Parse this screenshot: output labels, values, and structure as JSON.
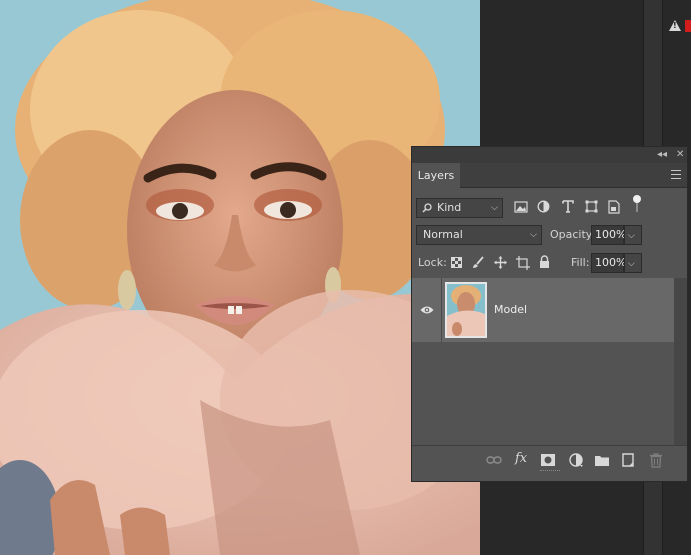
{
  "panel": {
    "tab_label": "Layers",
    "collapse_glyph": "◂◂",
    "close_glyph": "✕"
  },
  "filter": {
    "kind_label": "Kind",
    "filter_icons": [
      "image-filter-icon",
      "adjustment-filter-icon",
      "type-filter-icon",
      "shape-filter-icon",
      "smart-object-filter-icon"
    ]
  },
  "blend": {
    "mode": "Normal",
    "opacity_label": "Opacity:",
    "opacity_value": "100%"
  },
  "lock": {
    "label": "Lock:",
    "fill_label": "Fill:",
    "fill_value": "100%"
  },
  "layers": [
    {
      "name": "Model",
      "visible": true,
      "selected": true
    }
  ],
  "bottom_icons": [
    "link-layers-icon",
    "fx-icon",
    "add-mask-icon",
    "new-adjustment-icon",
    "new-group-icon",
    "new-layer-icon",
    "delete-layer-icon"
  ],
  "fx_label": "fx",
  "colors": {
    "panel_bg": "#535353",
    "selected_row": "#686868",
    "workspace": "#282828",
    "warning": "#d21d1d"
  }
}
